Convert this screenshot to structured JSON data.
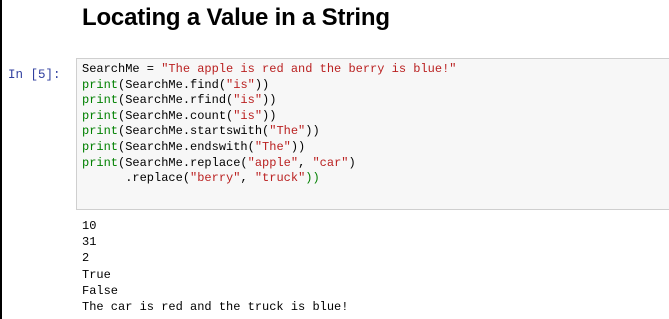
{
  "notebook": {
    "heading": "Locating a Value in a String",
    "cell": {
      "prompt": "In [5]:",
      "code_lines": [
        {
          "parts": [
            {
              "t": "SearchMe = ",
              "c": "op"
            },
            {
              "t": "\"The apple is red and the berry is blue!\"",
              "c": "str"
            }
          ]
        },
        {
          "parts": [
            {
              "t": "print",
              "c": "fn"
            },
            {
              "t": "(SearchMe.find(",
              "c": "op"
            },
            {
              "t": "\"is\"",
              "c": "str"
            },
            {
              "t": "))",
              "c": "op"
            }
          ]
        },
        {
          "parts": [
            {
              "t": "print",
              "c": "fn"
            },
            {
              "t": "(SearchMe.rfind(",
              "c": "op"
            },
            {
              "t": "\"is\"",
              "c": "str"
            },
            {
              "t": "))",
              "c": "op"
            }
          ]
        },
        {
          "parts": [
            {
              "t": "print",
              "c": "fn"
            },
            {
              "t": "(SearchMe.count(",
              "c": "op"
            },
            {
              "t": "\"is\"",
              "c": "str"
            },
            {
              "t": "))",
              "c": "op"
            }
          ]
        },
        {
          "parts": [
            {
              "t": "print",
              "c": "fn"
            },
            {
              "t": "(SearchMe.startswith(",
              "c": "op"
            },
            {
              "t": "\"The\"",
              "c": "str"
            },
            {
              "t": "))",
              "c": "op"
            }
          ]
        },
        {
          "parts": [
            {
              "t": "print",
              "c": "fn"
            },
            {
              "t": "(SearchMe.endswith(",
              "c": "op"
            },
            {
              "t": "\"The\"",
              "c": "str"
            },
            {
              "t": "))",
              "c": "op"
            }
          ]
        },
        {
          "parts": [
            {
              "t": "print",
              "c": "fn"
            },
            {
              "t": "(SearchMe.replace(",
              "c": "op"
            },
            {
              "t": "\"apple\"",
              "c": "str"
            },
            {
              "t": ", ",
              "c": "op"
            },
            {
              "t": "\"car\"",
              "c": "str"
            },
            {
              "t": ")",
              "c": "op"
            }
          ]
        },
        {
          "parts": [
            {
              "t": "      .replace(",
              "c": "op"
            },
            {
              "t": "\"berry\"",
              "c": "str"
            },
            {
              "t": ", ",
              "c": "op"
            },
            {
              "t": "\"truck\"",
              "c": "str"
            },
            {
              "t": "))",
              "c": "fn"
            }
          ]
        }
      ],
      "output_lines": [
        "10",
        "31",
        "2",
        "True",
        "False",
        "The car is red and the truck is blue!"
      ]
    },
    "colors": {
      "prompt": "#303f9f",
      "string": "#ba2121",
      "builtin": "#008000",
      "cell_background": "#f7f7f7",
      "cell_border": "#cfcfcf"
    }
  }
}
